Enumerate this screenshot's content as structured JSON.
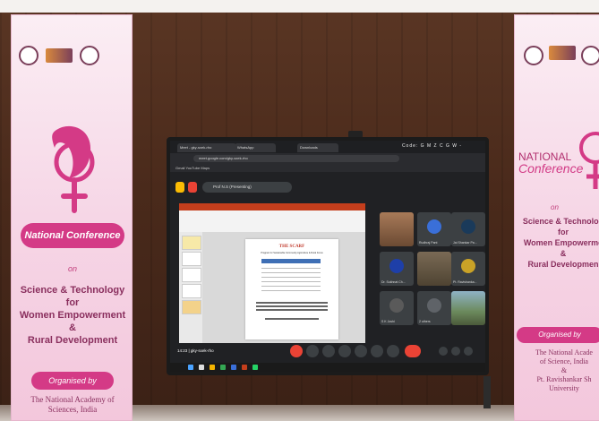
{
  "scene": {
    "wall_color": "#4a2a1b",
    "banner_pink": "#d43a86"
  },
  "left_banner": {
    "pill": "National Conference",
    "on": "on",
    "subject_lines": [
      "Science & Technology",
      "for",
      "Women Empowerment",
      "&",
      "Rural Development"
    ],
    "organized_by": "Organised by",
    "org_lines": [
      "The National Academy of",
      "Sciences, India"
    ]
  },
  "right_banner": {
    "title1": "NATIONAL",
    "title2": "Conference",
    "on": "on",
    "subject_lines": [
      "Science & Technolog",
      "for",
      "Women Empowerme",
      "&",
      "Rural Developmen"
    ],
    "organized_by": "Organised by",
    "org_lines": [
      "The National Acade",
      "of Science, India",
      "&",
      "Pt. Ravishankar Sh",
      "University"
    ]
  },
  "screen": {
    "browser": {
      "tabs": [
        "Meet - gky-sxek-rho",
        "WhatsApp",
        "Downloads"
      ],
      "meeting_code": "Code: G M Z C G W -",
      "url": "meet.google.com/gky-sxek-rho",
      "bookmarks": "Gmail   YouTube   Maps"
    },
    "presenter": "Prof N.S (Presenting)",
    "slide": {
      "title": "THE SCARF",
      "subtitle": "Program for Sustainable Community Agriculture & Rural Focus"
    },
    "participants": [
      {
        "name": "",
        "avatar": "",
        "type": "face"
      },
      {
        "name": "Rudhraj Pant",
        "avatar": "R",
        "type": "avatar",
        "color": "#3a6fd8"
      },
      {
        "name": "Jai Shankar Pa...",
        "avatar": "J",
        "type": "avatar",
        "color": "#1a3a5a"
      },
      {
        "name": "Dr. Sukhnat Ch...",
        "avatar": "D",
        "type": "avatar",
        "color": "#1e3fa8"
      },
      {
        "name": "",
        "avatar": "",
        "type": "room"
      },
      {
        "name": "Pt. Ravishanka...",
        "avatar": "P",
        "type": "avatar",
        "color": "#c9a227"
      },
      {
        "name": "S K Joshi",
        "avatar": "S",
        "type": "avatar",
        "color": "#5a5a5a"
      },
      {
        "name": "2 others",
        "avatar": "",
        "type": "avatar",
        "color": "#5f6368"
      },
      {
        "name": "",
        "avatar": "",
        "type": "photo"
      }
    ],
    "call_info": "14:23  |  gky-sxek-rho"
  }
}
